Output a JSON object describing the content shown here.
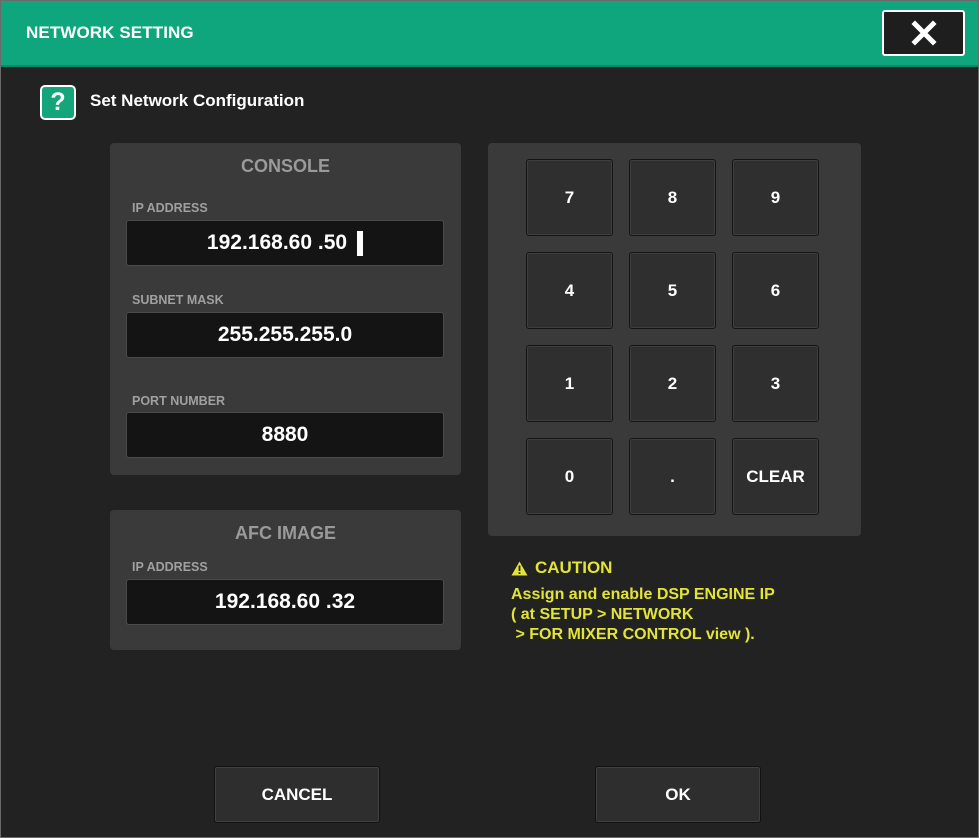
{
  "window": {
    "title": "NETWORK SETTING"
  },
  "header": {
    "help_symbol": "?",
    "subtitle": "Set Network Configuration"
  },
  "console": {
    "title": "CONSOLE",
    "ip_label": "IP ADDRESS",
    "ip_value": "192.168.60 .50",
    "subnet_label": "SUBNET MASK",
    "subnet_value": "255.255.255.0",
    "port_label": "PORT NUMBER",
    "port_value": "8880"
  },
  "afc_image": {
    "title": "AFC IMAGE",
    "ip_label": "IP ADDRESS",
    "ip_value": "192.168.60 .32"
  },
  "keypad": {
    "keys": [
      "7",
      "8",
      "9",
      "4",
      "5",
      "6",
      "1",
      "2",
      "3",
      "0",
      ".",
      "CLEAR"
    ]
  },
  "caution": {
    "heading": "CAUTION",
    "lines": [
      "Assign and enable DSP ENGINE IP",
      "( at SETUP > NETWORK",
      " > FOR MIXER CONTROL view )."
    ]
  },
  "buttons": {
    "cancel": "CANCEL",
    "ok": "OK"
  },
  "colors": {
    "titlebar": "#0fa67d",
    "caution": "#e2e437",
    "background": "#222222",
    "panel": "#3a3a3a"
  },
  "icons": {
    "close": "close-x-icon",
    "help": "help-icon",
    "warning": "warning-triangle-icon"
  }
}
